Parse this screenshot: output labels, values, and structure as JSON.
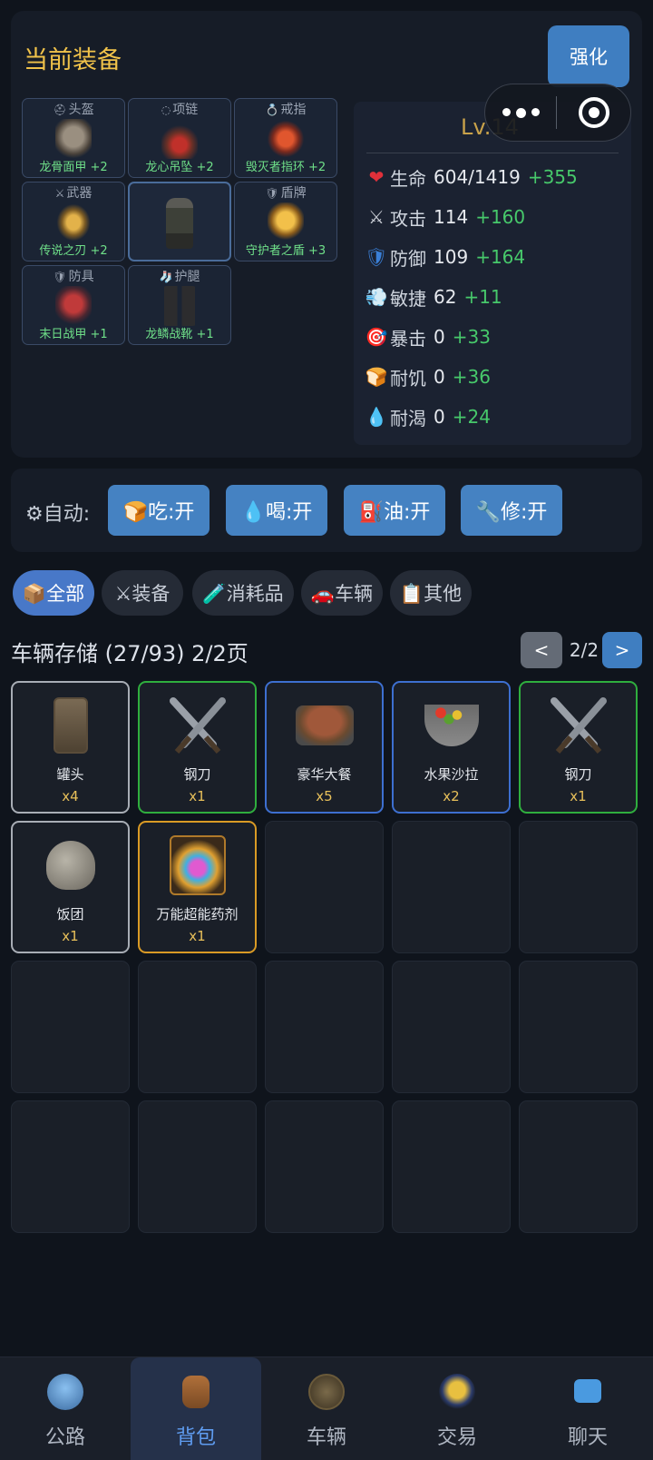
{
  "equipment": {
    "title": "当前装备",
    "enhance_label": "强化",
    "slots": [
      {
        "slot": "头盔",
        "slot_icon": "⛑",
        "item": "龙骨面甲 +2"
      },
      {
        "slot": "项链",
        "slot_icon": "◌",
        "item": "龙心吊坠 +2"
      },
      {
        "slot": "戒指",
        "slot_icon": "💍",
        "item": "毁灭者指环 +2"
      },
      {
        "slot": "武器",
        "slot_icon": "⚔",
        "item": "传说之刃 +2"
      },
      {
        "slot": "盾牌",
        "slot_icon": "🛡",
        "item": "守护者之盾 +3"
      },
      {
        "slot": "防具",
        "slot_icon": "🛡",
        "item": "末日战甲 +1"
      },
      {
        "slot": "护腿",
        "slot_icon": "🧦",
        "item": "龙鳞战靴 +1"
      }
    ]
  },
  "stats": {
    "level": "Lv.14",
    "rows": [
      {
        "icon": "❤",
        "label": "生命",
        "value": "604/1419",
        "bonus": "+355"
      },
      {
        "icon": "⚔",
        "label": "攻击",
        "value": "114",
        "bonus": "+160"
      },
      {
        "icon": "🛡",
        "label": "防御",
        "value": "109",
        "bonus": "+164"
      },
      {
        "icon": "💨",
        "label": "敏捷",
        "value": "62",
        "bonus": "+11"
      },
      {
        "icon": "🎯",
        "label": "暴击",
        "value": "0",
        "bonus": "+33"
      },
      {
        "icon": "🍞",
        "label": "耐饥",
        "value": "0",
        "bonus": "+36"
      },
      {
        "icon": "💧",
        "label": "耐渴",
        "value": "0",
        "bonus": "+24"
      }
    ]
  },
  "auto": {
    "label": "⚙自动:",
    "buttons": [
      "🍞吃:开",
      "💧喝:开",
      "⛽油:开",
      "🔧修:开"
    ]
  },
  "tabs": [
    "📦全部",
    "⚔装备",
    "🧪消耗品",
    "🚗车辆",
    "📋其他"
  ],
  "storage": {
    "title": "车辆存储 (27/93) 2/2页",
    "prev": "<",
    "page": "2/2",
    "next": ">",
    "items": [
      {
        "name": "罐头",
        "qty": "x4",
        "quality": "white"
      },
      {
        "name": "钢刀",
        "qty": "x1",
        "quality": "green"
      },
      {
        "name": "豪华大餐",
        "qty": "x5",
        "quality": "blue"
      },
      {
        "name": "水果沙拉",
        "qty": "x2",
        "quality": "blue"
      },
      {
        "name": "钢刀",
        "qty": "x1",
        "quality": "green"
      },
      {
        "name": "饭团",
        "qty": "x1",
        "quality": "white"
      },
      {
        "name": "万能超能药剂",
        "qty": "x1",
        "quality": "gold"
      }
    ]
  },
  "nav": [
    {
      "label": "公路",
      "icon": "road-icon"
    },
    {
      "label": "背包",
      "icon": "backpack-icon",
      "active": true
    },
    {
      "label": "车辆",
      "icon": "vehicle-icon"
    },
    {
      "label": "交易",
      "icon": "trade-icon"
    },
    {
      "label": "聊天",
      "icon": "chat-icon"
    }
  ]
}
